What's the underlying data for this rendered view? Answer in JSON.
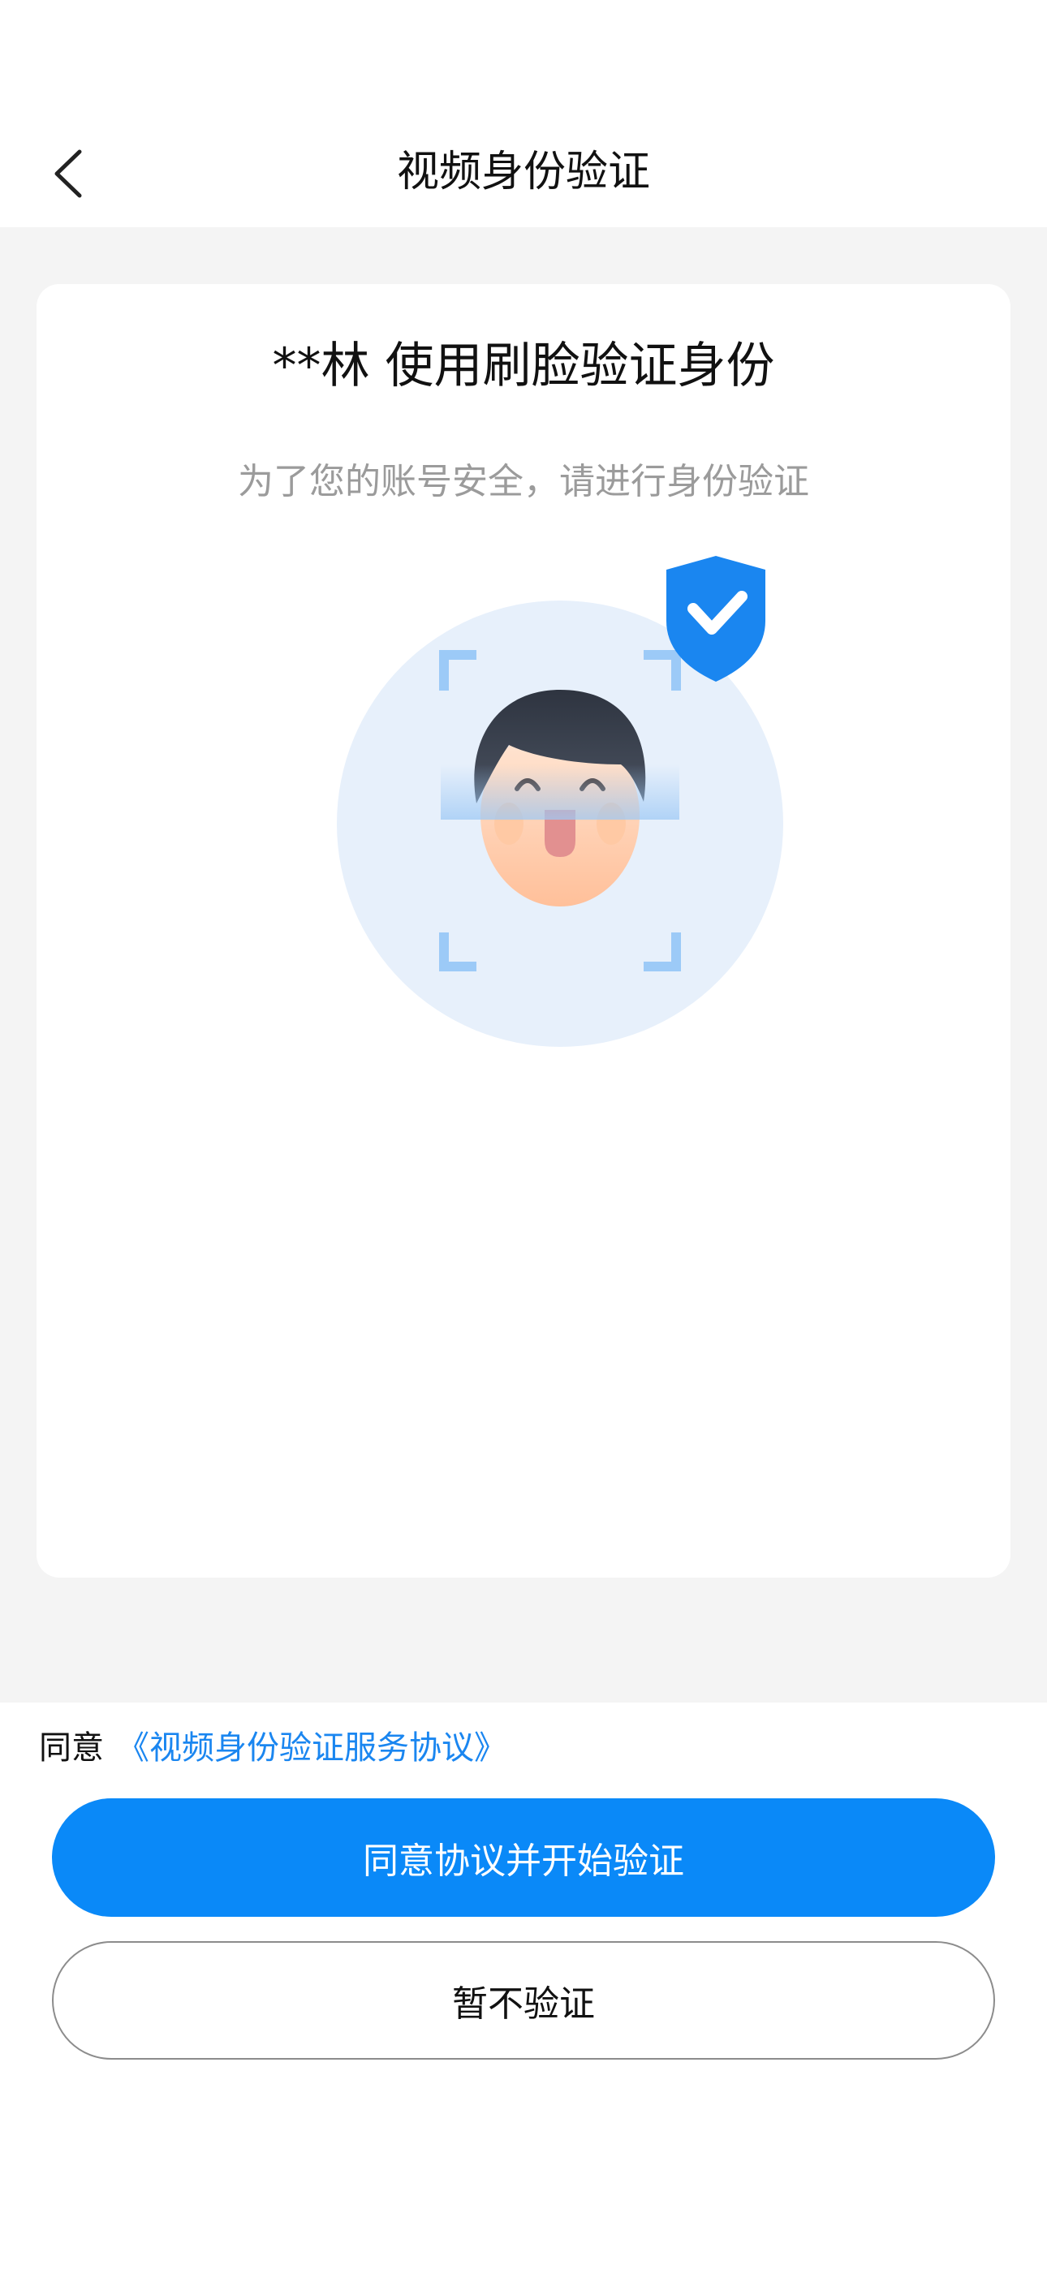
{
  "nav": {
    "back_icon": "chevron-left-icon",
    "title": "视频身份验证"
  },
  "card": {
    "title": "**林  使用刷脸验证身份",
    "subtitle": "为了您的账号安全，请进行身份验证",
    "illustration_icons": [
      "face-scan-icon",
      "shield-check-icon"
    ]
  },
  "agreement": {
    "prefix": "同意",
    "link": "《视频身份验证服务协议》"
  },
  "buttons": {
    "primary": "同意协议并开始验证",
    "secondary": "暂不验证"
  },
  "colors": {
    "accent": "#0a89f8",
    "link": "#1a86f0",
    "background": "#f4f4f4"
  }
}
